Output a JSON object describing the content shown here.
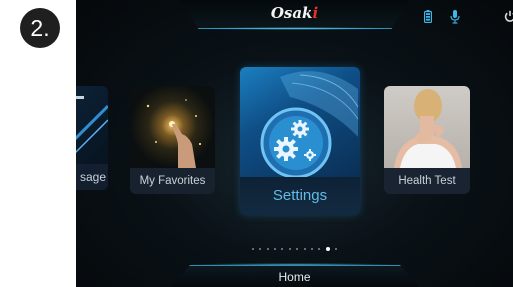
{
  "step_badge": "2.",
  "header": {
    "brand_prefix": "Osak",
    "brand_accent": "i",
    "icons": [
      "battery-icon",
      "microphone-icon",
      "power-icon"
    ]
  },
  "carousel": {
    "cards": [
      {
        "label": "sage",
        "icon": "massage-thumbnail"
      },
      {
        "label": "My Favorites",
        "icon": "hand-sparkle-thumbnail"
      },
      {
        "label": "Settings",
        "icon": "gears-thumbnail",
        "selected": true
      },
      {
        "label": "Health Test",
        "icon": "neck-pain-thumbnail"
      }
    ],
    "page_count": 12,
    "active_page": 11
  },
  "footer": {
    "home_label": "Home"
  },
  "colors": {
    "accent": "#62bbe6",
    "brand_red": "#e5322e",
    "icon_cyan": "#3fb6e8",
    "glow": "#2f8fb2"
  }
}
